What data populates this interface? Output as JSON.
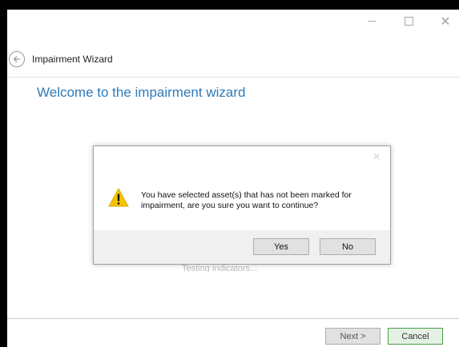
{
  "window": {
    "caption_buttons": {
      "minimize": "minimize-icon",
      "maximize": "maximize-icon",
      "close": "✕"
    }
  },
  "header": {
    "back_icon": "arrow-left-icon",
    "title": "Impairment Wizard"
  },
  "main": {
    "heading": "Welcome to the impairment wizard",
    "status": "Testing indicators..."
  },
  "footer": {
    "next_label": "Next >",
    "cancel_label": "Cancel"
  },
  "dialog": {
    "close_icon": "✕",
    "icon": "warning-icon",
    "message": "You have selected asset(s) that has not been marked for impairment, are you sure you want to continue?",
    "yes_label": "Yes",
    "no_label": "No"
  },
  "colors": {
    "heading": "#2f7ab8",
    "cancel_border": "#48a148",
    "warning": "#f5c400"
  }
}
